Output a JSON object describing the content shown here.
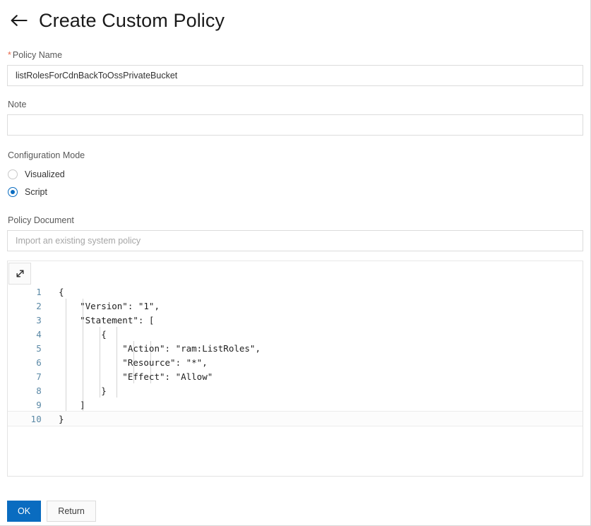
{
  "header": {
    "back_icon": "arrow-left-icon",
    "title": "Create Custom Policy"
  },
  "form": {
    "policy_name": {
      "required_marker": "*",
      "label": "Policy Name",
      "value": "listRolesForCdnBackToOssPrivateBucket",
      "placeholder": ""
    },
    "note": {
      "label": "Note",
      "value": "",
      "placeholder": ""
    },
    "configuration_mode": {
      "label": "Configuration Mode",
      "selected": "Script",
      "options": [
        {
          "label": "Visualized",
          "checked": false
        },
        {
          "label": "Script",
          "checked": true
        }
      ]
    },
    "policy_document": {
      "label": "Policy Document",
      "value": "",
      "placeholder": "Import an existing system policy"
    }
  },
  "editor": {
    "expand_icon": "expand-diagonal-icon",
    "active_line": 10,
    "lines": [
      {
        "n": "1",
        "text": "{"
      },
      {
        "n": "2",
        "text": "    \"Version\": \"1\","
      },
      {
        "n": "3",
        "text": "    \"Statement\": ["
      },
      {
        "n": "4",
        "text": "        {"
      },
      {
        "n": "5",
        "text": "            \"Action\": \"ram:ListRoles\","
      },
      {
        "n": "6",
        "text": "            \"Resource\": \"*\","
      },
      {
        "n": "7",
        "text": "            \"Effect\": \"Allow\""
      },
      {
        "n": "8",
        "text": "        }"
      },
      {
        "n": "9",
        "text": "    ]"
      },
      {
        "n": "10",
        "text": "}"
      }
    ]
  },
  "footer": {
    "ok_label": "OK",
    "return_label": "Return"
  },
  "colors": {
    "accent": "#0a6cc0",
    "required_star": "#e8684a",
    "line_number": "#5b89a6",
    "label": "#585858",
    "placeholder": "#a6a6a6",
    "border": "#dcdcdc"
  }
}
